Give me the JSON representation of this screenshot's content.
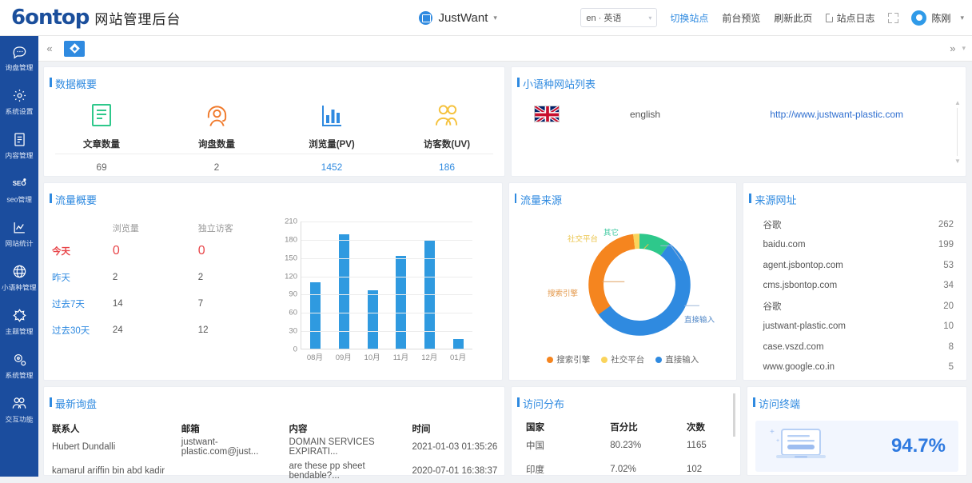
{
  "topbar": {
    "logo_main": "6ontop",
    "logo_suffix": "",
    "brand_title": "网站管理后台",
    "site_name": "JustWant",
    "site_caret": "▾",
    "lang_value": "en · 英语",
    "lang_arrow": "▾",
    "links": [
      {
        "label": "切换站点",
        "style": "blue"
      },
      {
        "label": "前台预览",
        "style": "plain"
      },
      {
        "label": "刷新此页",
        "style": "plain"
      },
      {
        "label": "站点日志",
        "style": "icon"
      }
    ],
    "user_name": "陈刚",
    "user_caret": "▾"
  },
  "sidebar": {
    "items": [
      {
        "label": "询盘管理",
        "icon": "chat-icon"
      },
      {
        "label": "系统设置",
        "icon": "gear-icon"
      },
      {
        "label": "内容管理",
        "icon": "document-icon"
      },
      {
        "label": "seo管理",
        "icon": "seo-icon"
      },
      {
        "label": "网站统计",
        "icon": "chart-icon"
      },
      {
        "label": "小语种管理",
        "icon": "globe-icon"
      },
      {
        "label": "主题管理",
        "icon": "theme-icon"
      },
      {
        "label": "系统管理",
        "icon": "settings-gear-icon"
      },
      {
        "label": "交互功能",
        "icon": "users-icon"
      }
    ]
  },
  "tabbar": {
    "collapse_icon": "«",
    "home_icon": "home-diamond-icon",
    "expand_icon": "»",
    "more_icon": "▾"
  },
  "data_overview": {
    "title": "数据概要",
    "stats": [
      {
        "label": "文章数量",
        "value": "69",
        "icon": "article-icon",
        "color": "#2ec88b",
        "blue": false
      },
      {
        "label": "询盘数量",
        "value": "2",
        "icon": "headset-icon",
        "color": "#f0792a",
        "blue": false
      },
      {
        "label": "浏览量(PV)",
        "value": "1452",
        "icon": "bars-icon",
        "color": "#2f8ae0",
        "blue": true
      },
      {
        "label": "访客数(UV)",
        "value": "186",
        "icon": "visitors-icon",
        "color": "#f5c23e",
        "blue": true
      }
    ]
  },
  "lang_sites": {
    "title": "小语种网站列表",
    "rows": [
      {
        "flag": "uk-flag-icon",
        "name": "english",
        "url": "http://www.justwant-plastic.com"
      }
    ]
  },
  "traffic_overview": {
    "title": "流量概要",
    "headers": [
      "",
      "浏览量",
      "独立访客"
    ],
    "rows": [
      {
        "period": "今天",
        "pv": "0",
        "uv": "0",
        "highlight": true
      },
      {
        "period": "昨天",
        "pv": "2",
        "uv": "2",
        "highlight": false
      },
      {
        "period": "过去7天",
        "pv": "14",
        "uv": "7",
        "highlight": false
      },
      {
        "period": "过去30天",
        "pv": "24",
        "uv": "12",
        "highlight": false
      }
    ]
  },
  "traffic_sources": {
    "title": "流量来源",
    "legend": [
      {
        "label": "搜索引擎",
        "color": "#f5851f"
      },
      {
        "label": "社交平台",
        "color": "#fad45c"
      },
      {
        "label": "直接输入",
        "color": "#2f8ae0"
      }
    ],
    "callouts": [
      {
        "label": "社交平台",
        "color": "#e8b93a"
      },
      {
        "label": "其它",
        "color": "#2ec88b"
      },
      {
        "label": "搜索引擎",
        "color": "#e08b3a"
      },
      {
        "label": "直接输入",
        "color": "#2f8ae0"
      }
    ]
  },
  "referrer": {
    "title": "来源网址",
    "rows": [
      {
        "name": "谷歌",
        "value": "262"
      },
      {
        "name": "baidu.com",
        "value": "199"
      },
      {
        "name": "agent.jsbontop.com",
        "value": "53"
      },
      {
        "name": "cms.jsbontop.com",
        "value": "34"
      },
      {
        "name": "谷歌",
        "value": "20"
      },
      {
        "name": "justwant-plastic.com",
        "value": "10"
      },
      {
        "name": "case.vszd.com",
        "value": "8"
      },
      {
        "name": "www.google.co.in",
        "value": "5"
      }
    ]
  },
  "latest_inquiry": {
    "title": "最新询盘",
    "headers": [
      "联系人",
      "邮箱",
      "内容",
      "时间"
    ],
    "rows": [
      {
        "contact": "Hubert Dundalli",
        "email": "justwant-plastic.com@just...",
        "content": "DOMAIN SERVICES EXPIRATI...",
        "time": "2021-01-03 01:35:26"
      },
      {
        "contact": "kamarul ariffin bin abd kadir",
        "email": "",
        "content": "are these pp sheet bendable?...",
        "time": "2020-07-01 16:38:37"
      }
    ]
  },
  "visit_distribution": {
    "title": "访问分布",
    "headers": [
      "国家",
      "百分比",
      "次数"
    ],
    "rows": [
      {
        "country": "中国",
        "percent": "80.23%",
        "count": "1165"
      },
      {
        "country": "印度",
        "percent": "7.02%",
        "count": "102"
      }
    ]
  },
  "visit_terminal": {
    "title": "访问终端",
    "icon": "laptop-icon",
    "percent": "94.7%"
  },
  "chart_data": [
    {
      "type": "bar",
      "title": "",
      "categories": [
        "08月",
        "09月",
        "10月",
        "11月",
        "12月",
        "01月"
      ],
      "values": [
        109,
        188,
        96,
        152,
        177,
        16
      ],
      "ylim": [
        0,
        210
      ],
      "yticks": [
        0,
        30,
        60,
        90,
        120,
        150,
        180,
        210
      ],
      "xlabel": "",
      "ylabel": "",
      "grid": true,
      "color": "#2f9ae0"
    },
    {
      "type": "pie",
      "title": "流量来源",
      "labels": [
        "搜索引擎",
        "社交平台",
        "直接输入",
        "其它"
      ],
      "values": [
        33,
        2,
        55,
        10
      ],
      "colors": [
        "#f5851f",
        "#fad45c",
        "#2f8ae0",
        "#2ec88b"
      ],
      "legend": "bottom",
      "donut": true
    }
  ]
}
